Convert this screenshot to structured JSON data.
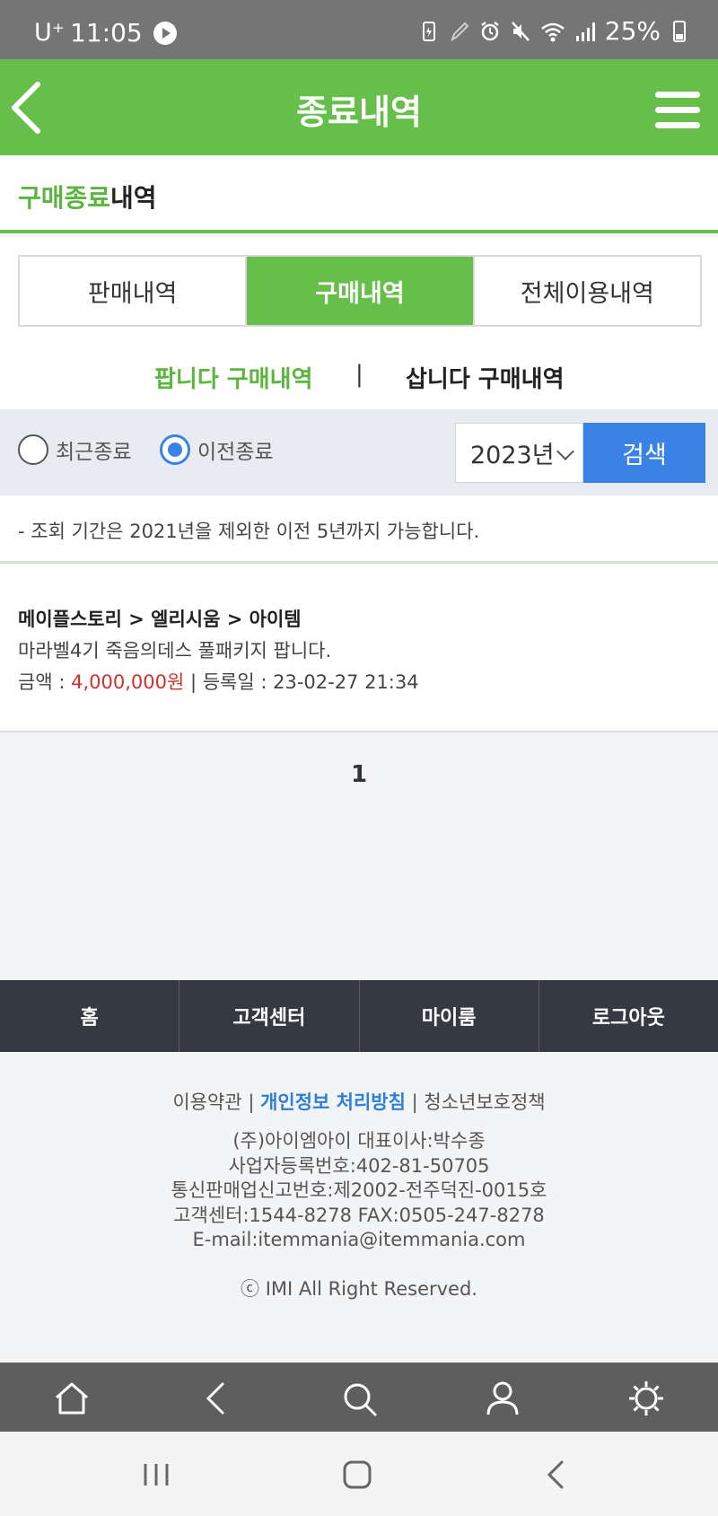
{
  "status_bar": {
    "carrier": "U⁺",
    "time": "11:05",
    "battery": "25%"
  },
  "header": {
    "title": "종료내역"
  },
  "section": {
    "title_highlight": "구매종료",
    "title_rest": "내역"
  },
  "tabs": [
    {
      "label": "판매내역",
      "active": false
    },
    {
      "label": "구매내역",
      "active": true
    },
    {
      "label": "전체이용내역",
      "active": false
    }
  ],
  "subtabs": {
    "sell": "팝니다 구매내역",
    "separator": "|",
    "buy": "삽니다 구매내역"
  },
  "filter": {
    "radio_recent": "최근종료",
    "radio_previous": "이전종료",
    "selected": "이전종료",
    "year": "2023년",
    "search_button": "검색"
  },
  "notice": "- 조회 기간은 2021년을 제외한 이전 5년까지 가능합니다.",
  "items": [
    {
      "category": "메이플스토리 > 엘리시움 > 아이템",
      "title": "마라벨4기 죽음의데스 풀패키지 팝니다.",
      "price_label": "금액 : ",
      "price": "4,000,000원",
      "date_label": " | 등록일 : 23-02-27 21:34"
    }
  ],
  "pagination": {
    "current": "1"
  },
  "footer_nav": [
    "홈",
    "고객센터",
    "마이룸",
    "로그아웃"
  ],
  "footer": {
    "terms": "이용약관",
    "sep1": " | ",
    "privacy": "개인정보 처리방침",
    "sep2": " | ",
    "youth": "청소년보호정책",
    "company_lines": [
      "(주)아이엠아이 대표이사:박수종",
      "사업자등록번호:402-81-50705",
      "통신판매업신고번호:제2002-전주덕진-0015호",
      "고객센터:1544-8278 FAX:0505-247-8278",
      "E-mail:itemmania@itemmania.com"
    ],
    "copyright": "ⓒ IMI All Right Reserved."
  },
  "browser_toolbar": [
    "home-icon",
    "back-icon",
    "search-icon",
    "user-icon",
    "settings-icon"
  ],
  "system_nav": [
    "recent-apps-icon",
    "home-icon",
    "back-icon"
  ],
  "colors": {
    "brand_green": "#66bf4b",
    "search_blue": "#3b82e6",
    "price_red": "#d0312d",
    "footer_dark": "#353a42"
  }
}
